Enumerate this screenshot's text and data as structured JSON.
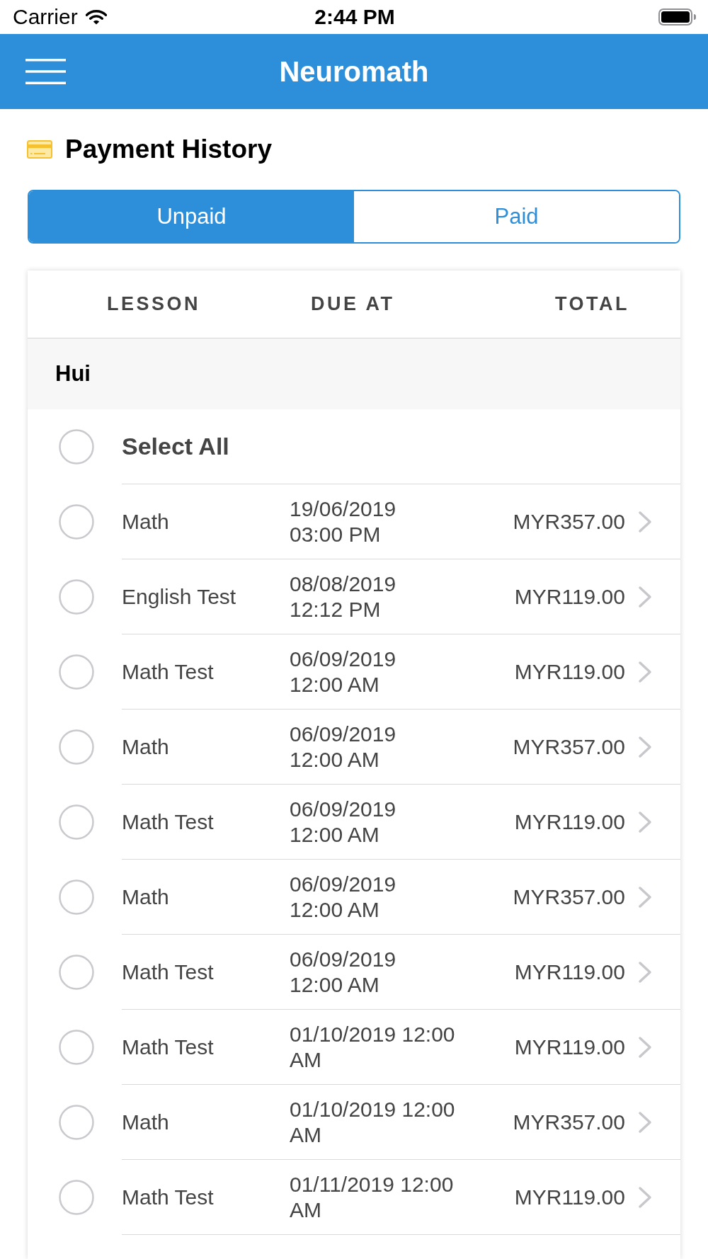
{
  "status_bar": {
    "carrier": "Carrier",
    "time": "2:44 PM"
  },
  "nav_bar": {
    "title": "Neuromath"
  },
  "page": {
    "title": "Payment History"
  },
  "tabs": [
    {
      "label": "Unpaid",
      "selected": true
    },
    {
      "label": "Paid",
      "selected": false
    }
  ],
  "table": {
    "columns": [
      "LESSON",
      "DUE AT",
      "TOTAL"
    ],
    "groups": [
      {
        "name": "Hui",
        "select_all": {
          "label": "Select All",
          "checked": false
        },
        "rows": [
          {
            "lesson": "Math",
            "due": "19/06/2019\n03:00 PM",
            "total": "MYR357.00",
            "selected": false
          },
          {
            "lesson": "English Test",
            "due": "08/08/2019\n12:12 PM",
            "total": "MYR119.00",
            "selected": false
          },
          {
            "lesson": "Math Test",
            "due": "06/09/2019\n12:00 AM",
            "total": "MYR119.00",
            "selected": false
          },
          {
            "lesson": "Math",
            "due": "06/09/2019\n12:00 AM",
            "total": "MYR357.00",
            "selected": false
          },
          {
            "lesson": "Math Test",
            "due": "06/09/2019\n12:00 AM",
            "total": "MYR119.00",
            "selected": false
          },
          {
            "lesson": "Math",
            "due": "06/09/2019\n12:00 AM",
            "total": "MYR357.00",
            "selected": false
          },
          {
            "lesson": "Math Test",
            "due": "06/09/2019\n12:00 AM",
            "total": "MYR119.00",
            "selected": false
          },
          {
            "lesson": "Math Test",
            "due": "01/10/2019 12:00 AM",
            "total": "MYR119.00",
            "selected": false
          },
          {
            "lesson": "Math",
            "due": "01/10/2019 12:00 AM",
            "total": "MYR357.00",
            "selected": false
          },
          {
            "lesson": "Math Test",
            "due": "01/11/2019 12:00 AM",
            "total": "MYR119.00",
            "selected": false
          }
        ]
      }
    ]
  }
}
